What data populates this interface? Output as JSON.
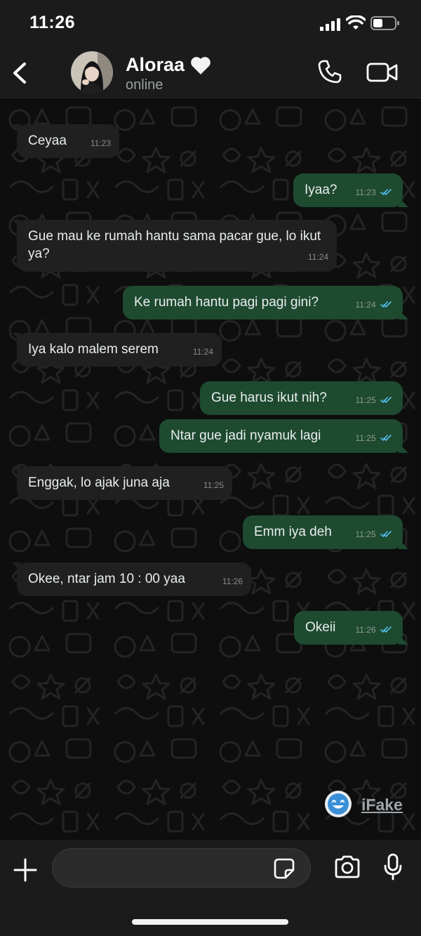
{
  "status_bar": {
    "time": "11:26"
  },
  "contact": {
    "name": "Aloraa",
    "status": "online"
  },
  "messages": [
    {
      "direction": "in",
      "text": "Ceyaa",
      "time": "11:23"
    },
    {
      "direction": "out",
      "text": "Iyaa?",
      "time": "11:23"
    },
    {
      "direction": "in",
      "text": "Gue mau ke rumah hantu sama pacar gue, lo ikut ya?",
      "time": "11:24"
    },
    {
      "direction": "out",
      "text": "Ke rumah hantu pagi pagi gini?",
      "time": "11:24"
    },
    {
      "direction": "in",
      "text": "Iya kalo malem serem",
      "time": "11:24"
    },
    {
      "direction": "out",
      "text": "Gue harus ikut nih?",
      "time": "11:25"
    },
    {
      "direction": "out",
      "text": "Ntar gue jadi nyamuk lagi",
      "time": "11:25"
    },
    {
      "direction": "in",
      "text": "Enggak, lo ajak juna aja",
      "time": "11:25"
    },
    {
      "direction": "out",
      "text": "Emm iya deh",
      "time": "11:25"
    },
    {
      "direction": "in",
      "text": "Okee, ntar jam 10 : 00 yaa",
      "time": "11:26"
    },
    {
      "direction": "out",
      "text": "Okeii",
      "time": "11:26"
    }
  ],
  "watermark": {
    "text": "iFake"
  },
  "composer": {
    "input_value": "",
    "input_placeholder": ""
  },
  "colors": {
    "incoming_bubble": "#202020",
    "outgoing_bubble": "#1e4a30",
    "read_tick": "#53bdeb",
    "background": "#0e0e0e"
  },
  "icons": [
    "back-chevron-icon",
    "heart-icon",
    "phone-icon",
    "video-camera-icon",
    "plus-icon",
    "sticker-icon",
    "camera-icon",
    "microphone-icon",
    "read-receipt-icon"
  ]
}
